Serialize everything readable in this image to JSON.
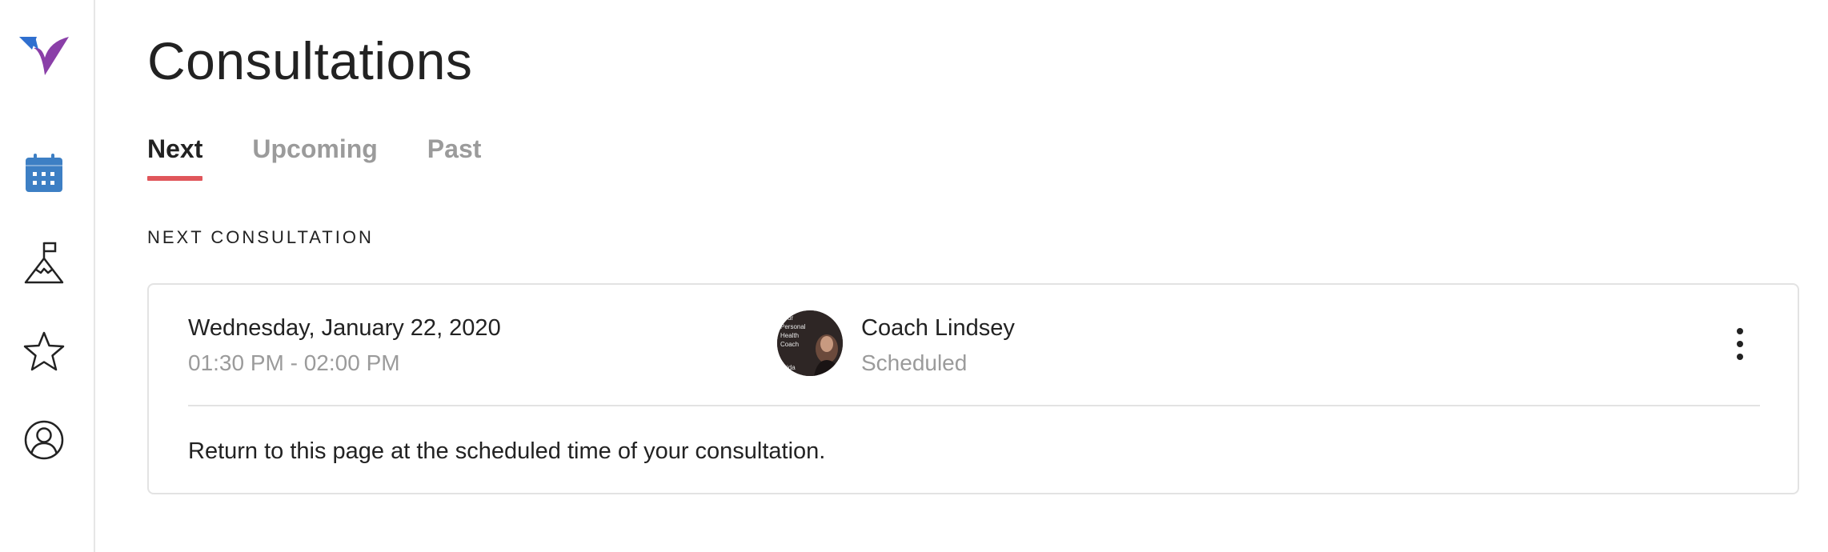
{
  "sidebar": {
    "logo": "brand-logo",
    "items": [
      {
        "name": "calendar-icon",
        "color": "#3d7fc4"
      },
      {
        "name": "mountain-flag-icon",
        "color": "#222222"
      },
      {
        "name": "star-icon",
        "color": "#222222"
      },
      {
        "name": "user-profile-icon",
        "color": "#222222"
      }
    ],
    "brand_colors": {
      "blue": "#2f6fcf",
      "purple": "#8a3fa8"
    }
  },
  "page": {
    "title": "Consultations",
    "tabs": [
      {
        "label": "Next",
        "active": true
      },
      {
        "label": "Upcoming",
        "active": false
      },
      {
        "label": "Past",
        "active": false
      }
    ],
    "accent_color": "#e0565b",
    "section_label": "NEXT CONSULTATION"
  },
  "consultation": {
    "date": "Wednesday, January 22, 2020",
    "time": "01:30 PM - 02:00 PM",
    "coach_name": "Coach Lindsey",
    "status": "Scheduled",
    "avatar_text": [
      "Your",
      "Personal",
      "Health",
      "Coach",
      "vida"
    ],
    "note": "Return to this page at the scheduled time of your consultation."
  }
}
